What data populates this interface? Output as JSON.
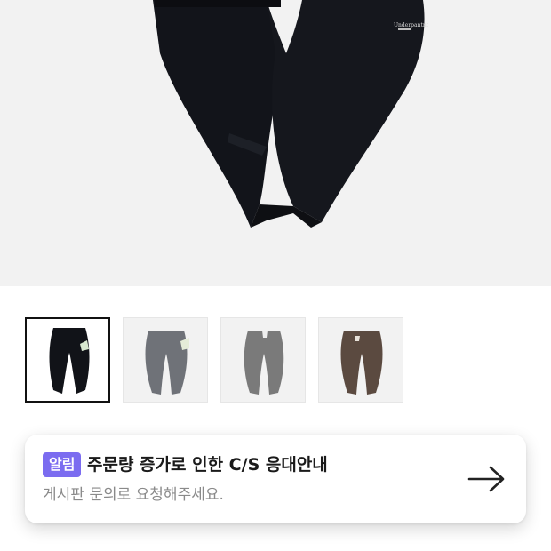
{
  "product": {
    "main_image": {
      "icon": "black-sweatpants-image",
      "brand_print": "Underpantnt"
    },
    "thumbnails": [
      {
        "color": "#111318",
        "selected": true
      },
      {
        "color": "#6f7278",
        "selected": false
      },
      {
        "color": "#7a7a7a",
        "selected": false
      },
      {
        "color": "#5b4a40",
        "selected": false
      }
    ]
  },
  "notice": {
    "badge": "알림",
    "title": "주문량 증가로 인한 C/S 응대안내",
    "subtitle": "게시판 문의로 요청해주세요.",
    "arrow_icon": "arrow-right-icon"
  }
}
